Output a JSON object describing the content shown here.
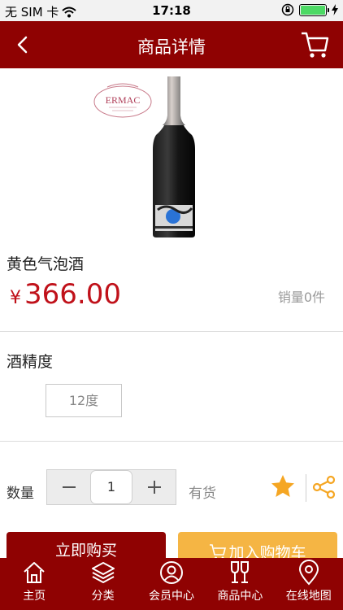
{
  "status_bar": {
    "carrier": "无 SIM 卡",
    "time": "17:18"
  },
  "nav": {
    "title": "商品详情",
    "back_icon": "chevron-left-icon",
    "cart_icon": "cart-icon"
  },
  "product": {
    "name": "黄色气泡酒",
    "currency_symbol": "¥",
    "price": "366.00",
    "sales": "销量0件",
    "logo_text": "ERMAC"
  },
  "spec": {
    "label": "酒精度",
    "options": [
      "12度"
    ]
  },
  "purchase": {
    "quantity_label": "数量",
    "quantity_value": "1",
    "stock": "有货",
    "buy_label": "立即购买",
    "add_cart_label": "加入购物车"
  },
  "tabbar": {
    "items": [
      {
        "label": "主页",
        "icon": "home-icon"
      },
      {
        "label": "分类",
        "icon": "layers-icon"
      },
      {
        "label": "会员中心",
        "icon": "member-icon"
      },
      {
        "label": "商品中心",
        "icon": "wine-glasses-icon"
      },
      {
        "label": "在线地图",
        "icon": "map-pin-icon"
      }
    ]
  },
  "colors": {
    "brand": "#8f0202",
    "price": "#c0111a",
    "accent": "#f5b544",
    "star": "#f5a623"
  }
}
